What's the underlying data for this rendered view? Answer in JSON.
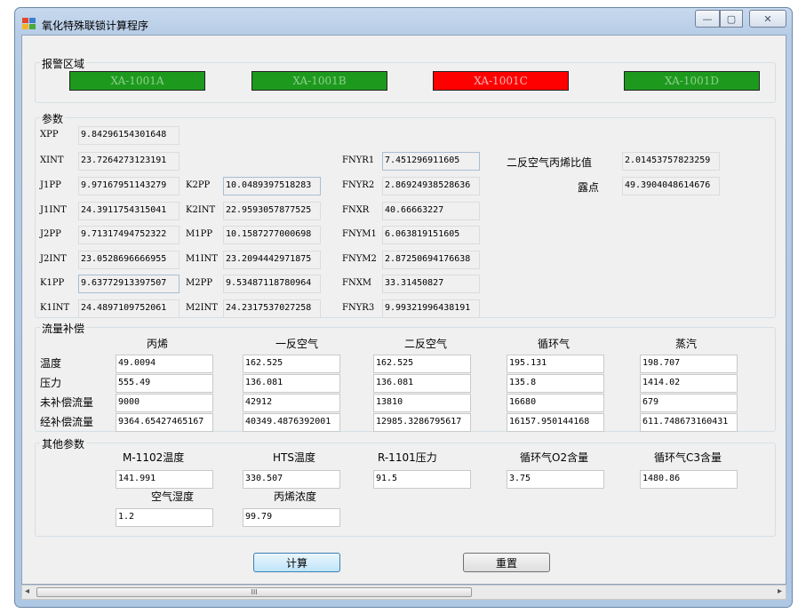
{
  "window": {
    "title": "氧化特殊联锁计算程序",
    "controls": {
      "minimize": "—",
      "maximize": "▢",
      "close": "✕"
    }
  },
  "alarm": {
    "title": "报警区域",
    "items": [
      {
        "label": "XA-1001A",
        "color": "#1d9a1d"
      },
      {
        "label": "XA-1001B",
        "color": "#1d9a1d"
      },
      {
        "label": "XA-1001C",
        "color": "#ff0000"
      },
      {
        "label": "XA-1001D",
        "color": "#1d9a1d"
      }
    ]
  },
  "params": {
    "title": "参数",
    "XPP": {
      "label": "XPP",
      "value": "9.84296154301648"
    },
    "XINT": {
      "label": "XINT",
      "value": "23.7264273123191"
    },
    "J1PP": {
      "label": "J1PP",
      "value": "9.97167951143279"
    },
    "J1INT": {
      "label": "J1INT",
      "value": "24.3911754315041"
    },
    "J2PP": {
      "label": "J2PP",
      "value": "9.71317494752322"
    },
    "J2INT": {
      "label": "J2INT",
      "value": "23.0528696666955"
    },
    "K1PP": {
      "label": "K1PP",
      "value": "9.63772913397507"
    },
    "K1INT": {
      "label": "K1INT",
      "value": "24.4897109752061"
    },
    "K2PP": {
      "label": "K2PP",
      "value": "10.0489397518283"
    },
    "K2INT": {
      "label": "K2INT",
      "value": "22.9593057877525"
    },
    "M1PP": {
      "label": "M1PP",
      "value": "10.1587277000698"
    },
    "M1INT": {
      "label": "M1INT",
      "value": "23.2094442971875"
    },
    "M2PP": {
      "label": "M2PP",
      "value": "9.53487118780964"
    },
    "M2INT": {
      "label": "M2INT",
      "value": "24.2317537027258"
    },
    "FNYR1": {
      "label": "FNYR1",
      "value": "7.451296911605"
    },
    "FNYR2": {
      "label": "FNYR2",
      "value": "2.86924938528636"
    },
    "FNXR": {
      "label": "FNXR",
      "value": "40.66663227"
    },
    "FNYM1": {
      "label": "FNYM1",
      "value": "6.063819151605"
    },
    "FNYM2": {
      "label": "FNYM2",
      "value": "2.87250694176638"
    },
    "FNXM": {
      "label": "FNXM",
      "value": "33.31450827"
    },
    "FNYR3": {
      "label": "FNYR3",
      "value": "9.99321996438191"
    },
    "ratio": {
      "label": "二反空气丙烯比值",
      "value": "2.01453757823259"
    },
    "dew": {
      "label": "露点",
      "value": "49.3904048614676"
    }
  },
  "flow": {
    "title": "流量补偿",
    "columns": [
      "丙烯",
      "一反空气",
      "二反空气",
      "循环气",
      "蒸汽"
    ],
    "rows": [
      {
        "label": "温度",
        "values": [
          "49.0094",
          "162.525",
          "162.525",
          "195.131",
          "198.707"
        ]
      },
      {
        "label": "压力",
        "values": [
          "555.49",
          "136.081",
          "136.081",
          "135.8",
          "1414.02"
        ]
      },
      {
        "label": "未补偿流量",
        "values": [
          "9000",
          "42912",
          "13810",
          "16680",
          "679"
        ]
      },
      {
        "label": "经补偿流量",
        "values": [
          "9364.65427465167",
          "40349.4876392001",
          "12985.3286795617",
          "16157.950144168",
          "611.748673160431"
        ]
      }
    ]
  },
  "other": {
    "title": "其他参数",
    "row1_labels": [
      "M-1102温度",
      "HTS温度",
      "R-1101压力",
      "循环气O2含量",
      "循环气C3含量"
    ],
    "row1_values": [
      "141.991",
      "330.507",
      "91.5",
      "3.75",
      "1480.86"
    ],
    "row2_labels": [
      "空气湿度",
      "丙烯浓度"
    ],
    "row2_values": [
      "1.2",
      "99.79"
    ]
  },
  "buttons": {
    "calc": "计算",
    "reset": "重置"
  },
  "scrollbar": {
    "left": "◂",
    "right": "▸",
    "grip": "III"
  }
}
